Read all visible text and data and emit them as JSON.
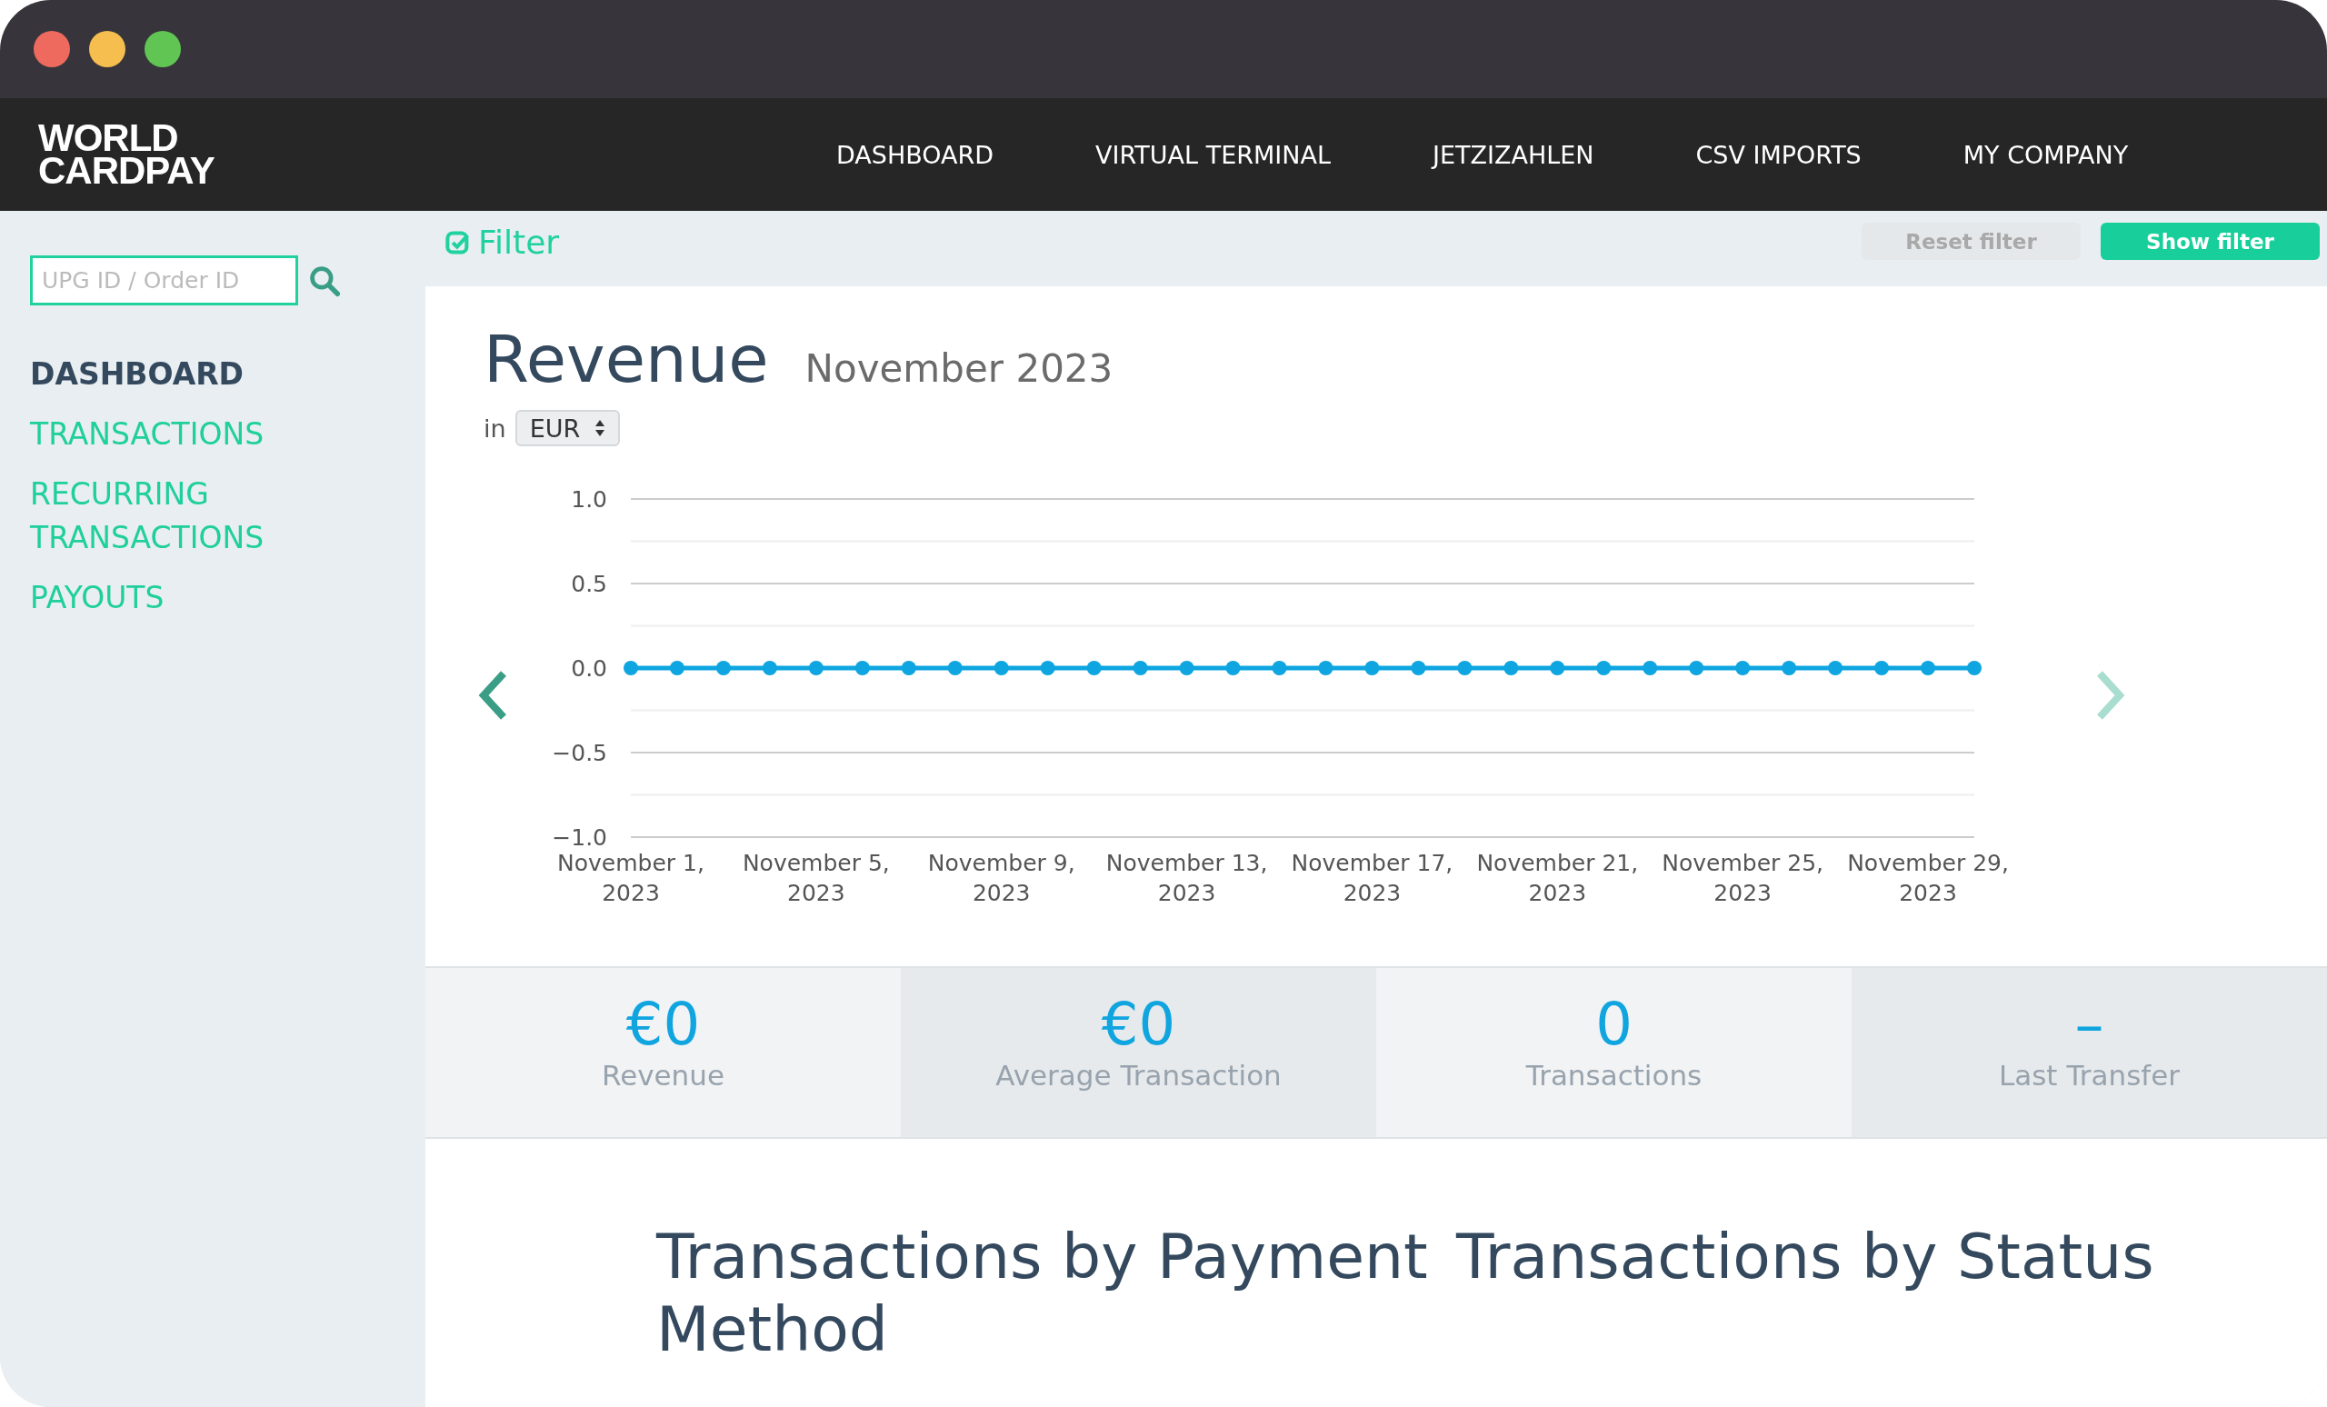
{
  "header": {
    "logo": [
      "WORLD",
      "CARDPAY"
    ],
    "nav": [
      {
        "label": "DASHBOARD"
      },
      {
        "label": "VIRTUAL TERMINAL"
      },
      {
        "label": "JETZIZAHLEN"
      },
      {
        "label": "CSV IMPORTS"
      },
      {
        "label": "MY COMPANY"
      }
    ]
  },
  "sidebar": {
    "search": {
      "placeholder": "UPG ID / Order ID"
    },
    "items": [
      {
        "label": "DASHBOARD",
        "selected": true
      },
      {
        "label": "TRANSACTIONS",
        "selected": false
      },
      {
        "label": "RECURRING TRANSACTIONS",
        "selected": false
      },
      {
        "label": "PAYOUTS",
        "selected": false
      }
    ]
  },
  "filter_bar": {
    "label": "Filter",
    "buttons": [
      {
        "label": "Reset filter",
        "disabled": true
      },
      {
        "label": "Show filter",
        "disabled": false
      }
    ]
  },
  "revenue": {
    "title": "Revenue",
    "period": "November 2023",
    "currency_prefix": "in",
    "currency": "EUR",
    "prev": {
      "disabled": false
    },
    "next": {
      "disabled": true
    },
    "chart_data": {
      "type": "line",
      "categories": [
        "November 1, 2023",
        null,
        null,
        null,
        "November 5, 2023",
        null,
        null,
        null,
        "November 9, 2023",
        null,
        null,
        null,
        "November 13, 2023",
        null,
        null,
        null,
        "November 17, 2023",
        null,
        null,
        null,
        "November 21, 2023",
        null,
        null,
        null,
        "November 25, 2023",
        null,
        null,
        null,
        "November 29, 2023",
        null
      ],
      "series": [
        {
          "color": "#0ea5e0",
          "marker": "circle",
          "values": [
            0,
            0,
            0,
            0,
            0,
            0,
            0,
            0,
            0,
            0,
            0,
            0,
            0,
            0,
            0,
            0,
            0,
            0,
            0,
            0,
            0,
            0,
            0,
            0,
            0,
            0,
            0,
            0,
            0,
            0
          ]
        }
      ],
      "ylim": [
        -1,
        1
      ],
      "yticks": [
        {
          "value": 1,
          "label": "1.0"
        },
        {
          "value": 0.5,
          "label": "0.5"
        },
        {
          "value": 0,
          "label": "0.0"
        },
        {
          "value": -0.5,
          "label": "−0.5"
        },
        {
          "value": -1,
          "label": "−1.0"
        }
      ]
    }
  },
  "stats": [
    {
      "value": "€0",
      "label": "Revenue"
    },
    {
      "value": "€0",
      "label": "Average Transaction"
    },
    {
      "value": "0",
      "label": "Transactions"
    },
    {
      "value": "–",
      "label": "Last Transfer"
    }
  ],
  "sections": [
    {
      "title": "Transactions by Payment Method"
    },
    {
      "title": "Transactions by Status"
    }
  ]
}
